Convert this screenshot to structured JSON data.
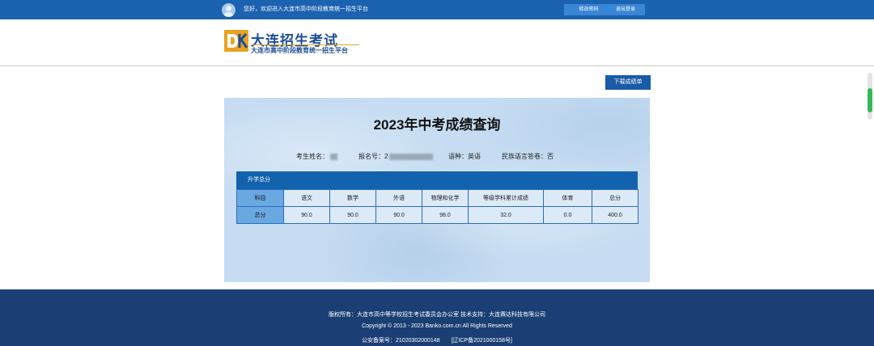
{
  "topbar": {
    "welcome": "您好，欢迎进入大连市高中阶段教育统一招生平台",
    "change_password": "修改密码",
    "logout": "退出登录"
  },
  "header": {
    "logo_title": "大连招生考试",
    "logo_subtitle": "大连市高中阶段教育统一招生平台"
  },
  "actions": {
    "download": "下载成绩单"
  },
  "panel": {
    "title": "2023年中考成绩查询",
    "info": {
      "name_label": "考生姓名：",
      "reg_label": "报名号：2",
      "language": "语种：英语",
      "minority": "民族语言答卷：否"
    }
  },
  "scores": {
    "section_title": "升学总分",
    "row_subject_label": "科目",
    "row_value_label": "总分",
    "subjects": [
      "语文",
      "数学",
      "外语",
      "物理和化学",
      "等级学科累计成绩",
      "体育",
      "总分"
    ],
    "values": [
      "90.0",
      "90.0",
      "90.0",
      "98.0",
      "32.0",
      "0.0",
      "400.0"
    ]
  },
  "footer": {
    "copyright_owner": "版权所有：大连市高中等学校招生考试委员会办公室  技术支持：大连赛达科技有限公司",
    "copyright": "Copyright © 2013 - 2023 Banko.com.cn All Rights Reserved",
    "police_record": "公安备案号：21020302000148",
    "icp": "[辽ICP备2021000158号]"
  },
  "colors": {
    "topbar": "#1b62b0",
    "footer": "#1b3f74",
    "panel": "#c6dcf2",
    "table_header": "#1262ad",
    "accent": "#1a5ba8"
  },
  "icons": [
    "avatar-icon",
    "logo-mark-icon"
  ]
}
